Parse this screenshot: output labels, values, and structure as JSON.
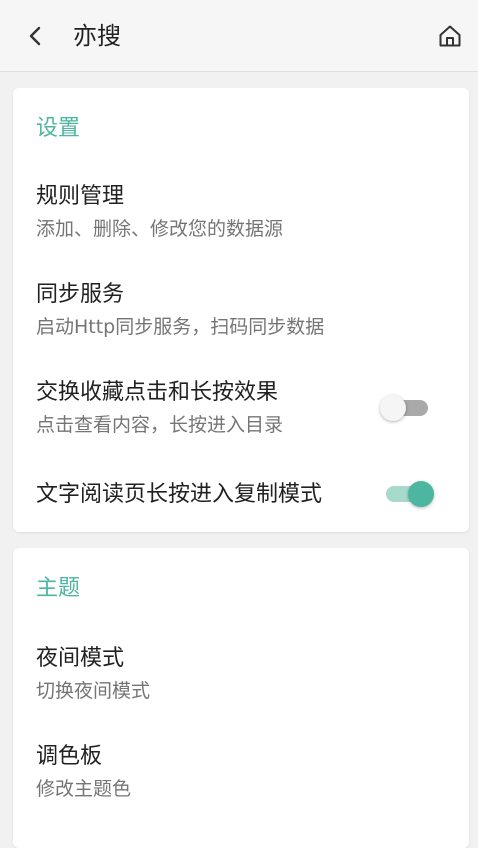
{
  "app_bar": {
    "title": "亦搜",
    "back_icon": "chevron-left-icon",
    "home_icon": "home-icon"
  },
  "sections": {
    "settings": {
      "title": "设置",
      "items": [
        {
          "title": "规则管理",
          "summary": "添加、删除、修改您的数据源"
        },
        {
          "title": "同步服务",
          "summary": "启动Http同步服务，扫码同步数据"
        },
        {
          "title": "交换收藏点击和长按效果",
          "summary": "点击查看内容，长按进入目录",
          "switch_on": false
        },
        {
          "title": "文字阅读页长按进入复制模式",
          "switch_on": true
        }
      ]
    },
    "theme": {
      "title": "主题",
      "items": [
        {
          "title": "夜间模式",
          "summary": "切换夜间模式"
        },
        {
          "title": "调色板",
          "summary": "修改主题色"
        }
      ]
    }
  },
  "colors": {
    "accent": "#4db6a1",
    "accent_track": "#a7d9cd",
    "switch_off_track": "#a9a9a9",
    "background": "#f1f1f1",
    "card": "#ffffff"
  }
}
